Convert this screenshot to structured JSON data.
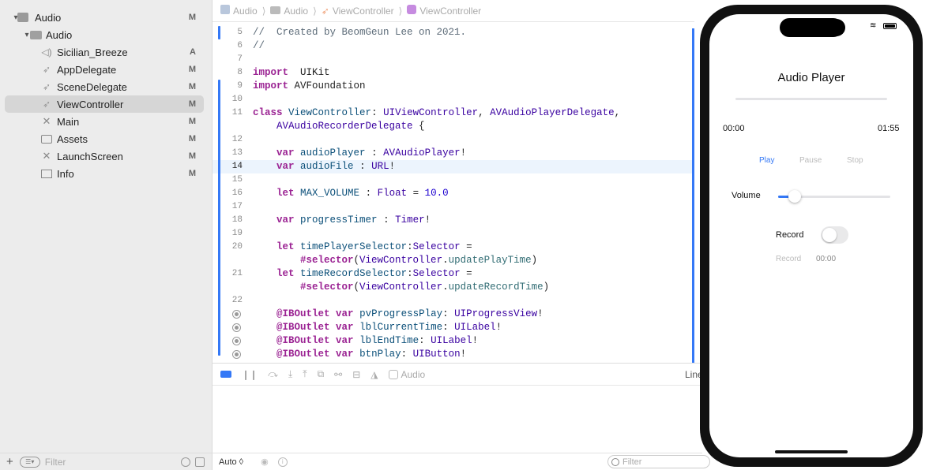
{
  "navigator": {
    "items": [
      {
        "label": "Audio",
        "status": "M",
        "icon": "project-icon",
        "disclosure": "▾"
      },
      {
        "label": "Audio",
        "status": "",
        "icon": "folder-icon",
        "disclosure": "▾"
      },
      {
        "label": "Sicilian_Breeze",
        "status": "A",
        "icon": "speaker-icon",
        "disclosure": ""
      },
      {
        "label": "AppDelegate",
        "status": "M",
        "icon": "swift-icon",
        "disclosure": ""
      },
      {
        "label": "SceneDelegate",
        "status": "M",
        "icon": "swift-icon",
        "disclosure": ""
      },
      {
        "label": "ViewController",
        "status": "M",
        "icon": "swift-icon",
        "disclosure": ""
      },
      {
        "label": "Main",
        "status": "M",
        "icon": "storyboard-icon",
        "disclosure": ""
      },
      {
        "label": "Assets",
        "status": "M",
        "icon": "assets-icon",
        "disclosure": ""
      },
      {
        "label": "LaunchScreen",
        "status": "M",
        "icon": "storyboard-icon",
        "disclosure": ""
      },
      {
        "label": "Info",
        "status": "M",
        "icon": "plist-icon",
        "disclosure": ""
      }
    ],
    "filter_placeholder": "Filter"
  },
  "jumpbar": {
    "crumbs": [
      "Audio",
      "Audio",
      "ViewController",
      "ViewController"
    ]
  },
  "code": {
    "lines": [
      {
        "n": "5",
        "tokens": [
          [
            "cm",
            "//  Created by BeomGeun Lee on 2021."
          ]
        ]
      },
      {
        "n": "6",
        "tokens": [
          [
            "cm",
            "//"
          ]
        ]
      },
      {
        "n": "7",
        "tokens": []
      },
      {
        "n": "8",
        "tokens": [
          [
            "kw",
            "import"
          ],
          [
            "",
            "  UIKit"
          ]
        ]
      },
      {
        "n": "9",
        "tokens": [
          [
            "kw",
            "import"
          ],
          [
            "",
            " AVFoundation"
          ]
        ]
      },
      {
        "n": "10",
        "tokens": []
      },
      {
        "n": "11",
        "tokens": [
          [
            "kw",
            "class"
          ],
          [
            "",
            " "
          ],
          [
            "tp",
            "ViewController"
          ],
          [
            "",
            ": "
          ],
          [
            "ty",
            "UIViewController"
          ],
          [
            "",
            ", "
          ],
          [
            "ty",
            "AVAudioPlayerDelegate"
          ],
          [
            "",
            ","
          ]
        ]
      },
      {
        "n": "",
        "tokens": [
          [
            "",
            "    "
          ],
          [
            "ty",
            "AVAudioRecorderDelegate"
          ],
          [
            "",
            " {"
          ]
        ]
      },
      {
        "n": "12",
        "tokens": []
      },
      {
        "n": "13",
        "tokens": [
          [
            "",
            "    "
          ],
          [
            "kw",
            "var"
          ],
          [
            "",
            " "
          ],
          [
            "tp",
            "audioPlayer"
          ],
          [
            "",
            " : "
          ],
          [
            "ty",
            "AVAudioPlayer"
          ],
          [
            "",
            "!"
          ]
        ]
      },
      {
        "n": "14",
        "tokens": [
          [
            "",
            "    "
          ],
          [
            "kw",
            "var"
          ],
          [
            "",
            " "
          ],
          [
            "tp",
            "audioFile"
          ],
          [
            "",
            " : "
          ],
          [
            "ty",
            "URL"
          ],
          [
            "",
            "!"
          ]
        ],
        "hl": true
      },
      {
        "n": "15",
        "tokens": []
      },
      {
        "n": "16",
        "tokens": [
          [
            "",
            "    "
          ],
          [
            "kw",
            "let"
          ],
          [
            "",
            " "
          ],
          [
            "tp",
            "MAX_VOLUME"
          ],
          [
            "",
            " : "
          ],
          [
            "ty",
            "Float"
          ],
          [
            "",
            " = "
          ],
          [
            "nm",
            "10.0"
          ]
        ]
      },
      {
        "n": "17",
        "tokens": []
      },
      {
        "n": "18",
        "tokens": [
          [
            "",
            "    "
          ],
          [
            "kw",
            "var"
          ],
          [
            "",
            " "
          ],
          [
            "tp",
            "progressTimer"
          ],
          [
            "",
            " : "
          ],
          [
            "ty",
            "Timer"
          ],
          [
            "",
            "!"
          ]
        ]
      },
      {
        "n": "19",
        "tokens": []
      },
      {
        "n": "20",
        "tokens": [
          [
            "",
            "    "
          ],
          [
            "kw",
            "let"
          ],
          [
            "",
            " "
          ],
          [
            "tp",
            "timePlayerSelector"
          ],
          [
            "",
            ":"
          ],
          [
            "ty",
            "Selector"
          ],
          [
            "",
            " ="
          ]
        ]
      },
      {
        "n": "",
        "tokens": [
          [
            "",
            "        "
          ],
          [
            "kw",
            "#selector"
          ],
          [
            "",
            "("
          ],
          [
            "ty",
            "ViewController"
          ],
          [
            "",
            "."
          ],
          [
            "mt",
            "updatePlayTime"
          ],
          [
            "",
            ")"
          ]
        ]
      },
      {
        "n": "21",
        "tokens": [
          [
            "",
            "    "
          ],
          [
            "kw",
            "let"
          ],
          [
            "",
            " "
          ],
          [
            "tp",
            "timeRecordSelector"
          ],
          [
            "",
            ":"
          ],
          [
            "ty",
            "Selector"
          ],
          [
            "",
            " ="
          ]
        ]
      },
      {
        "n": "",
        "tokens": [
          [
            "",
            "        "
          ],
          [
            "kw",
            "#selector"
          ],
          [
            "",
            "("
          ],
          [
            "ty",
            "ViewController"
          ],
          [
            "",
            "."
          ],
          [
            "mt",
            "updateRecordTime"
          ],
          [
            "",
            ")"
          ]
        ]
      },
      {
        "n": "22",
        "tokens": []
      },
      {
        "n": "",
        "bp": true,
        "tokens": [
          [
            "",
            "    "
          ],
          [
            "kw",
            "@IBOutlet"
          ],
          [
            "",
            " "
          ],
          [
            "kw",
            "var"
          ],
          [
            "",
            " "
          ],
          [
            "tp",
            "pvProgressPlay"
          ],
          [
            "",
            ": "
          ],
          [
            "ty",
            "UIProgressView"
          ],
          [
            "",
            "!"
          ]
        ]
      },
      {
        "n": "",
        "bp": true,
        "tokens": [
          [
            "",
            "    "
          ],
          [
            "kw",
            "@IBOutlet"
          ],
          [
            "",
            " "
          ],
          [
            "kw",
            "var"
          ],
          [
            "",
            " "
          ],
          [
            "tp",
            "lblCurrentTime"
          ],
          [
            "",
            ": "
          ],
          [
            "ty",
            "UILabel"
          ],
          [
            "",
            "!"
          ]
        ]
      },
      {
        "n": "",
        "bp": true,
        "tokens": [
          [
            "",
            "    "
          ],
          [
            "kw",
            "@IBOutlet"
          ],
          [
            "",
            " "
          ],
          [
            "kw",
            "var"
          ],
          [
            "",
            " "
          ],
          [
            "tp",
            "lblEndTime"
          ],
          [
            "",
            ": "
          ],
          [
            "ty",
            "UILabel"
          ],
          [
            "",
            "!"
          ]
        ]
      },
      {
        "n": "",
        "bp": true,
        "tokens": [
          [
            "",
            "    "
          ],
          [
            "kw",
            "@IBOutlet"
          ],
          [
            "",
            " "
          ],
          [
            "kw",
            "var"
          ],
          [
            "",
            " "
          ],
          [
            "tp",
            "btnPlay"
          ],
          [
            "",
            ": "
          ],
          [
            "ty",
            "UIButton"
          ],
          [
            "",
            "!"
          ]
        ]
      }
    ]
  },
  "debugbar": {
    "target": "Audio",
    "line_label": "Line"
  },
  "console": {
    "mode": "Auto ◊",
    "filter_placeholder": "Filter"
  },
  "simulator": {
    "title": "Audio Player",
    "current_time": "00:00",
    "end_time": "01:55",
    "progress": 0.0,
    "buttons": {
      "play": "Play",
      "pause": "Pause",
      "stop": "Stop"
    },
    "volume_label": "Volume",
    "volume_value": 0.1,
    "record_label": "Record",
    "record_on": false,
    "record_button": "Record",
    "record_time": "00:00"
  },
  "colors": {
    "accent": "#3478f6",
    "keyword": "#9b2393",
    "type": "#3900a0"
  }
}
